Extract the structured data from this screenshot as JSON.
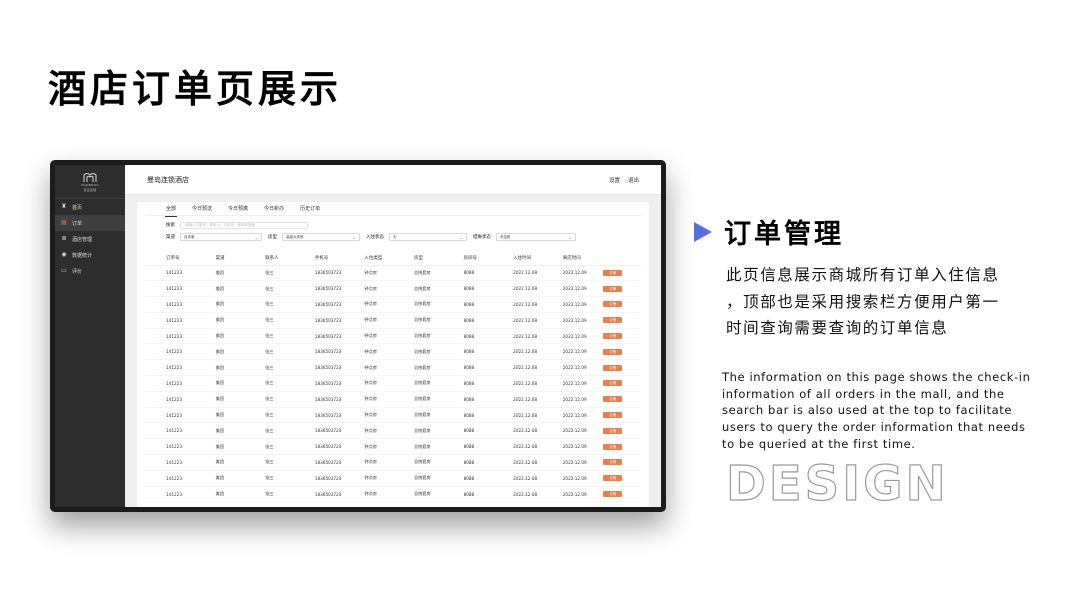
{
  "page_title": "酒店订单页展示",
  "app": {
    "brand": "MANNDOO",
    "brand_sub": "曼岛连锁",
    "header_title": "曼岛连锁酒店",
    "header_links": [
      "设置",
      "退出"
    ],
    "sidebar": [
      {
        "label": "首页",
        "icon": "home-icon",
        "glyph": "♜"
      },
      {
        "label": "订单",
        "icon": "document-icon",
        "glyph": "▤",
        "active": true
      },
      {
        "label": "酒店管理",
        "icon": "list-icon",
        "glyph": "≣"
      },
      {
        "label": "数据统计",
        "icon": "user-icon",
        "glyph": "◉"
      },
      {
        "label": "评价",
        "icon": "comment-icon",
        "glyph": "▭"
      }
    ],
    "tabs": [
      "全部",
      "今日预送",
      "今日预离",
      "今日新办",
      "历史订单"
    ],
    "search": {
      "label": "搜索",
      "placeholder": "请输入订单号、联系人、手机号、房间号搜索"
    },
    "filters": [
      {
        "label": "渠道",
        "value": "自来客"
      },
      {
        "label": "房型",
        "value": "高级大床房"
      },
      {
        "label": "入住状态",
        "value": "无"
      },
      {
        "label": "结账状态",
        "value": "未结账"
      }
    ],
    "table": {
      "columns": [
        "订单号",
        "渠道",
        "联系人",
        "手机号",
        "入住类型",
        "房型",
        "房间号",
        "入住时间",
        "离店时间",
        ""
      ],
      "rows": [
        [
          "141223",
          "美团",
          "张三",
          "1836503723",
          "钟点房",
          "总统套房",
          "8088",
          "2022.12.08",
          "2022.12.09",
          "订房"
        ],
        [
          "141223",
          "美团",
          "张三",
          "1836503723",
          "钟点房",
          "总统套房",
          "8088",
          "2022.12.08",
          "2022.12.09",
          "订房"
        ],
        [
          "141223",
          "美团",
          "张三",
          "1836503723",
          "钟点房",
          "总统套房",
          "8088",
          "2022.12.08",
          "2022.12.09",
          "订房"
        ],
        [
          "141223",
          "美团",
          "张三",
          "1836503723",
          "钟点房",
          "总统套房",
          "8088",
          "2022.12.08",
          "2022.12.09",
          "订房"
        ],
        [
          "141223",
          "美团",
          "张三",
          "1836503723",
          "钟点房",
          "总统套房",
          "8088",
          "2022.12.08",
          "2022.12.09",
          "订房"
        ],
        [
          "141223",
          "美团",
          "张三",
          "1836503723",
          "钟点房",
          "总统套房",
          "8088",
          "2022.12.08",
          "2022.12.09",
          "订房"
        ],
        [
          "141223",
          "美团",
          "张三",
          "1836503723",
          "钟点房",
          "总统套房",
          "8088",
          "2022.12.08",
          "2022.12.09",
          "订房"
        ],
        [
          "141223",
          "美团",
          "张三",
          "1836503723",
          "钟点房",
          "总统套房",
          "8088",
          "2022.12.08",
          "2022.12.09",
          "订房"
        ],
        [
          "141223",
          "美团",
          "张三",
          "1836503723",
          "钟点房",
          "总统套房",
          "8088",
          "2022.12.08",
          "2022.12.09",
          "订房"
        ],
        [
          "141223",
          "美团",
          "张三",
          "1836503723",
          "钟点房",
          "总统套房",
          "8088",
          "2022.12.08",
          "2022.12.09",
          "订房"
        ],
        [
          "141223",
          "美团",
          "张三",
          "1836503723",
          "钟点房",
          "总统套房",
          "8088",
          "2022.12.08",
          "2022.12.09",
          "订房"
        ],
        [
          "141223",
          "美团",
          "张三",
          "1836503723",
          "钟点房",
          "总统套房",
          "8088",
          "2022.12.08",
          "2022.12.09",
          "订房"
        ],
        [
          "141223",
          "美团",
          "张三",
          "1836503723",
          "钟点房",
          "总统套房",
          "8088",
          "2022.12.08",
          "2022.12.09",
          "订房"
        ],
        [
          "141223",
          "美团",
          "张三",
          "1836503723",
          "钟点房",
          "总统套房",
          "8088",
          "2022.12.08",
          "2022.12.09",
          "订房"
        ],
        [
          "141223",
          "美团",
          "张三",
          "1836503723",
          "钟点房",
          "总统套房",
          "8088",
          "2022.12.08",
          "2022.12.09",
          "订房"
        ]
      ]
    }
  },
  "section": {
    "title": "订单管理",
    "cn_lines": [
      "此页信息展示商城所有订单入住信息",
      "，顶部也是采用搜索栏方便用户第一",
      "时间查询需要查询的订单信息"
    ],
    "en_lines": [
      "The information on this page shows the check-in",
      "information of all orders in the mall, and the",
      "search bar is also used at the top to facilitate",
      "users to query the order information that needs",
      "to be queried at the first time."
    ],
    "watermark": "DESIGN"
  },
  "colors": {
    "accent": "#e8804a",
    "arrow": "#5b6ee1",
    "sidebar": "#2d2d2d"
  }
}
